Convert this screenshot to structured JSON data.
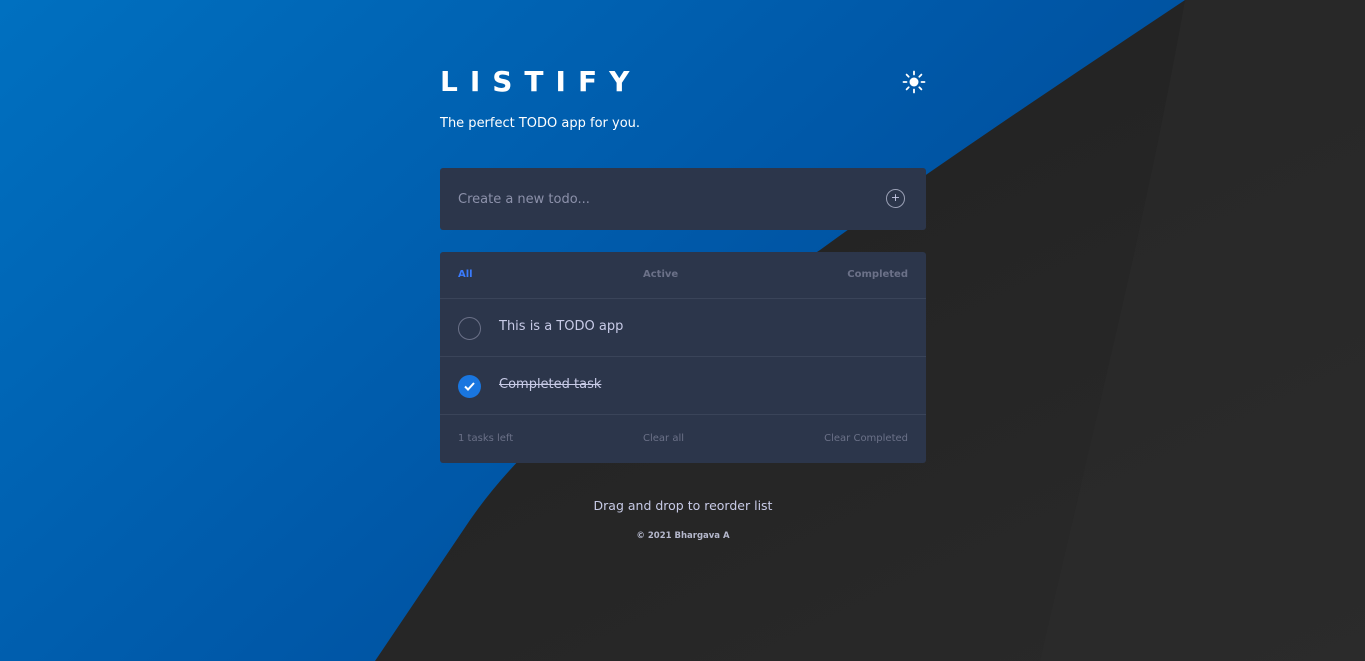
{
  "header": {
    "title": "LISTIFY",
    "subtitle": "The perfect TODO app for you.",
    "theme_icon": "sun-icon"
  },
  "new_todo": {
    "placeholder": "Create a new todo...",
    "add_icon": "plus-circle-icon"
  },
  "filters": {
    "all": "All",
    "active": "Active",
    "completed": "Completed",
    "selected": "All"
  },
  "todos": [
    {
      "text": "This is a TODO app",
      "completed": false
    },
    {
      "text": "Completed task",
      "completed": true
    }
  ],
  "footer": {
    "count": "1",
    "count_label": " tasks left",
    "clear_all": "Clear all",
    "clear_completed": "Clear Completed"
  },
  "hint": "Drag and drop to reorder list",
  "copyright": "© 2021 Bhargava A",
  "colors": {
    "accent": "#3a7bfd",
    "check_fill": "#1976e0",
    "card_bg": "#2c364b",
    "page_blue": "#0066b8",
    "page_dark": "#252525"
  }
}
